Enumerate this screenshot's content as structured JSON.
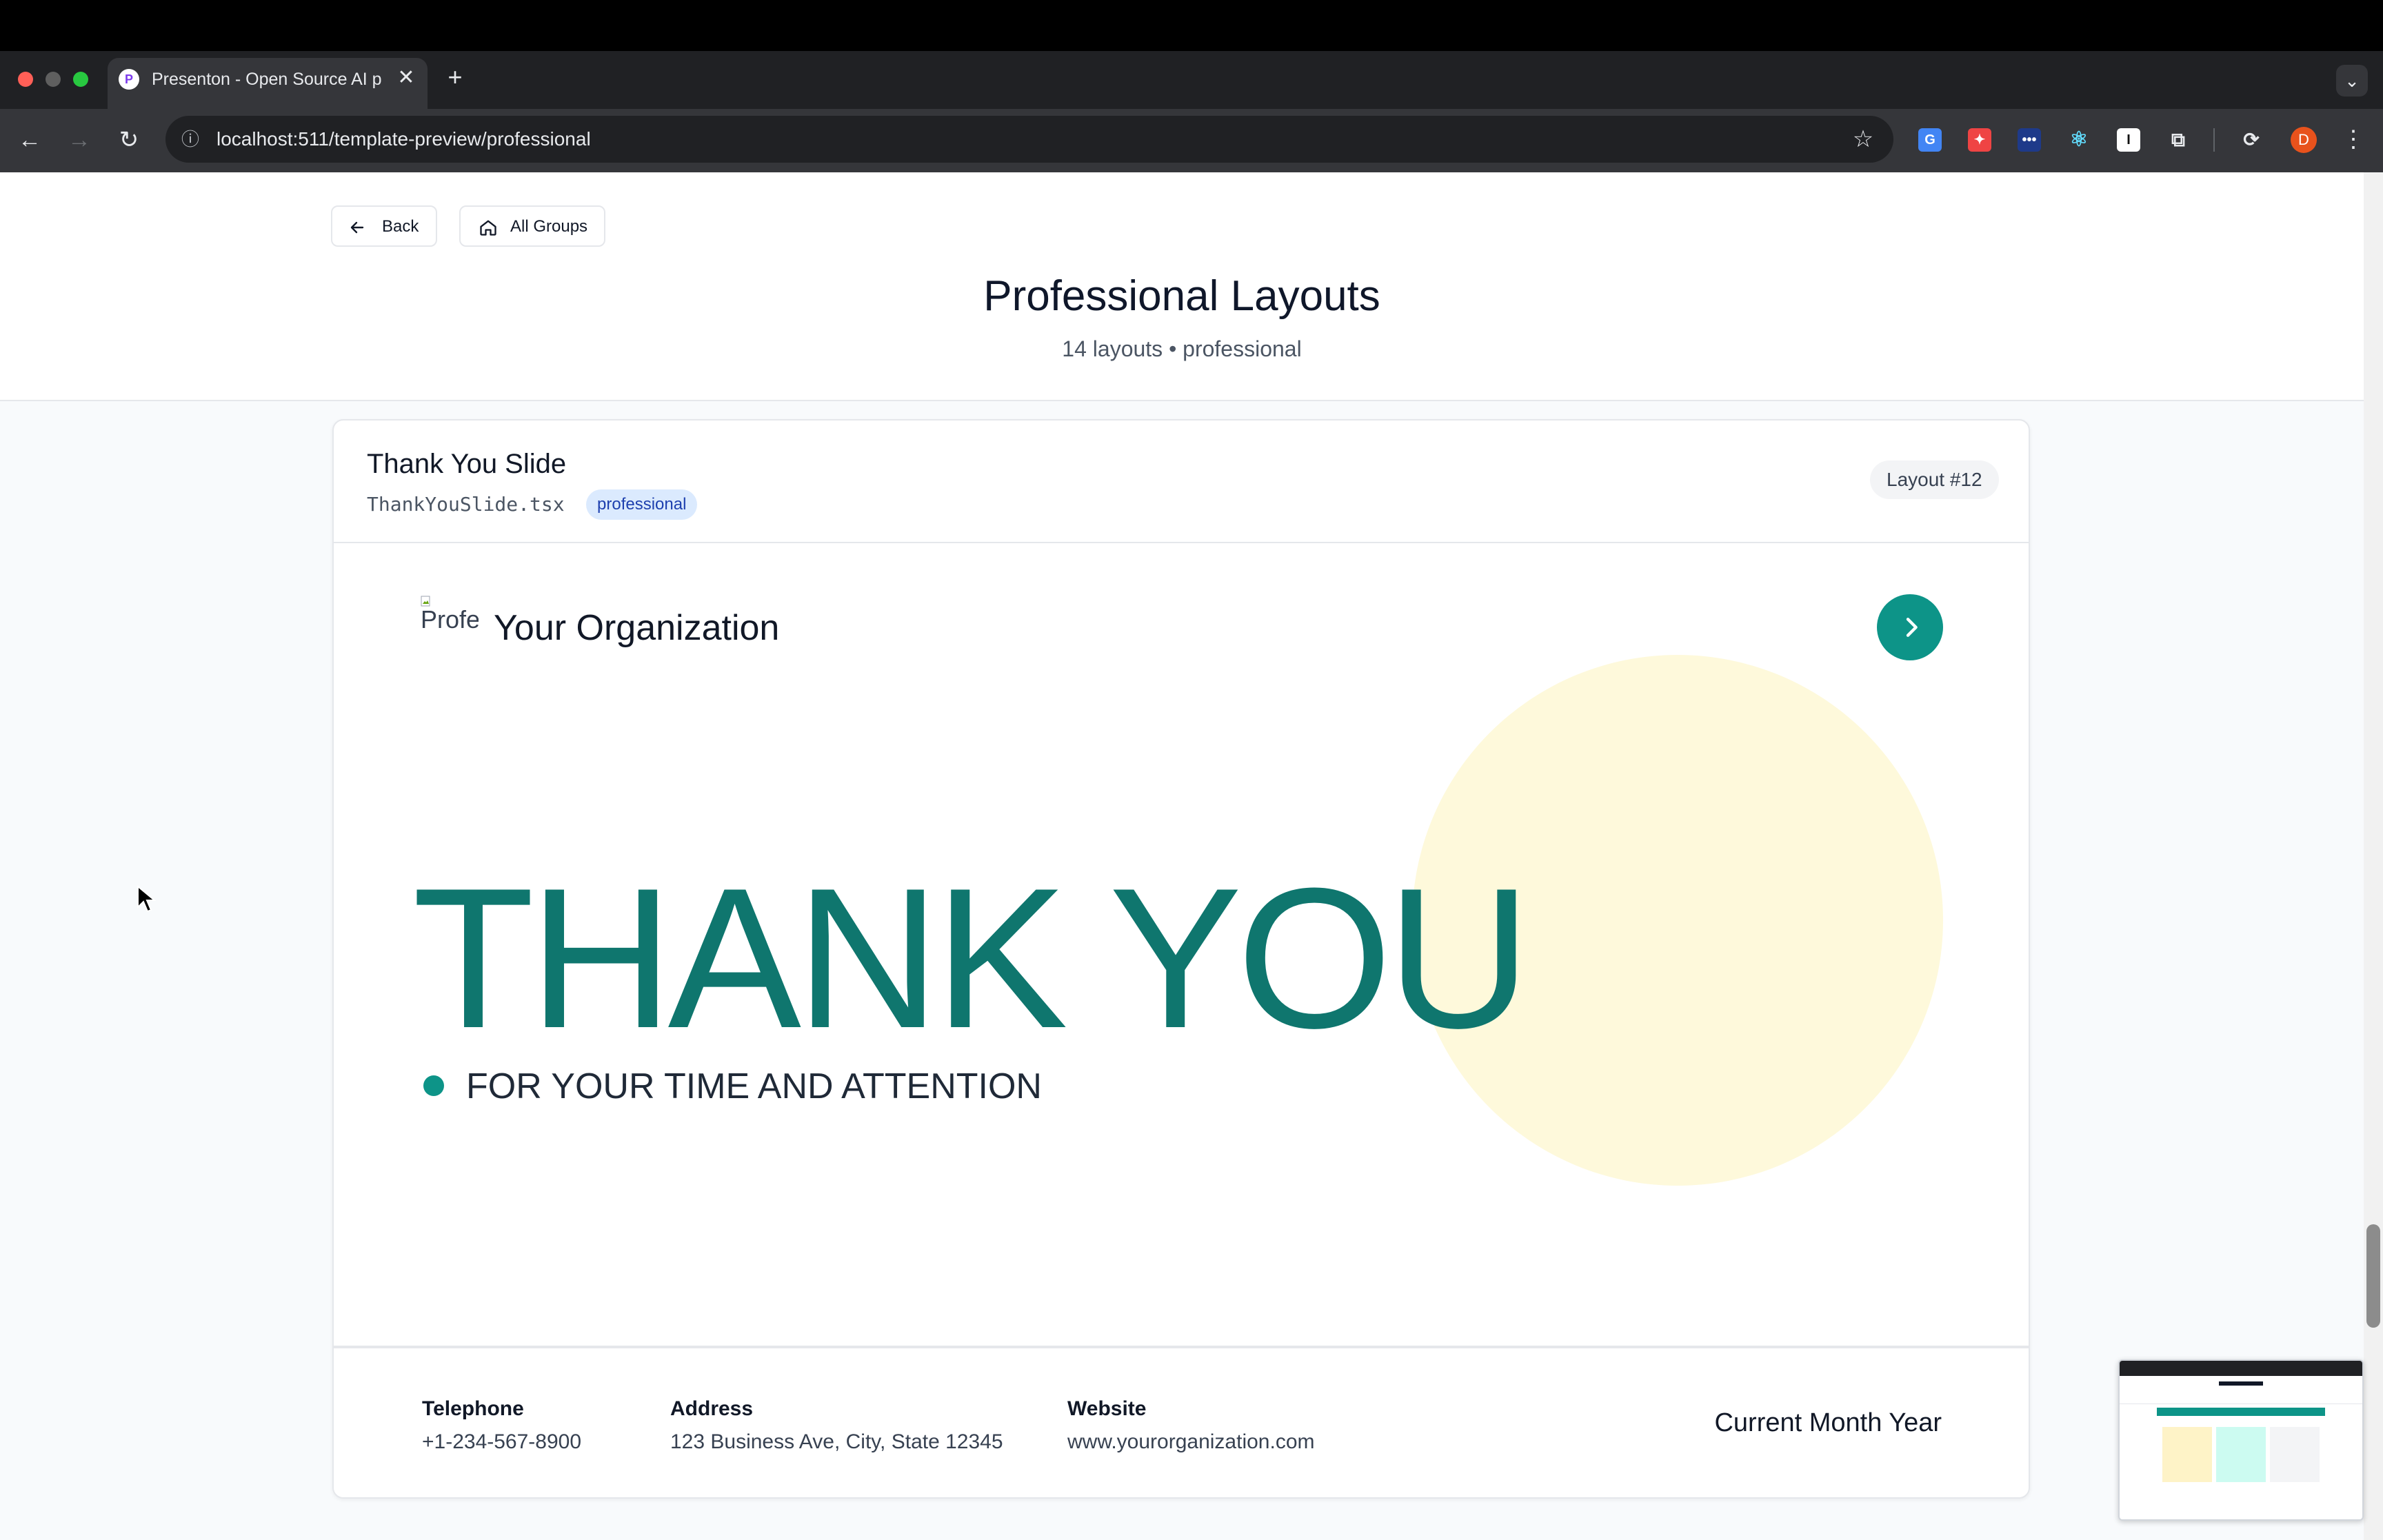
{
  "browser": {
    "tab_title": "Presenton - Open Source AI p",
    "tab_close": "✕",
    "new_tab": "+",
    "tab_menu": "⌄",
    "url": "localhost:511/template-preview/professional",
    "back": "←",
    "forward": "→",
    "reload": "↻",
    "star": "☆",
    "site_info": "ⓘ",
    "favicon_letter": "P",
    "profile_initial": "D",
    "menu": "⋮",
    "extensions": [
      "google-translate",
      "rocket",
      "password-dots",
      "react-devtools",
      "reader",
      "puzzle",
      "sync"
    ]
  },
  "header": {
    "back_label": "Back",
    "all_groups_label": "All Groups",
    "title": "Professional Layouts",
    "subtitle": "14 layouts • professional"
  },
  "card": {
    "name": "Thank You Slide",
    "file": "ThankYouSlide.tsx",
    "tag": "professional",
    "layout_number": "Layout #12"
  },
  "slide": {
    "logo_alt": "Professional",
    "org_name": "Your Organization",
    "title": "THANK YOU",
    "subtitle": "FOR YOUR TIME AND ATTENTION",
    "accent_color": "#0f766e",
    "circle_color": "#fef9db",
    "footer": {
      "telephone_label": "Telephone",
      "telephone": "+1-234-567-8900",
      "address_label": "Address",
      "address": "123 Business Ave, City, State 12345",
      "website_label": "Website",
      "website": "www.yourorganization.com",
      "date": "Current Month Year"
    }
  }
}
